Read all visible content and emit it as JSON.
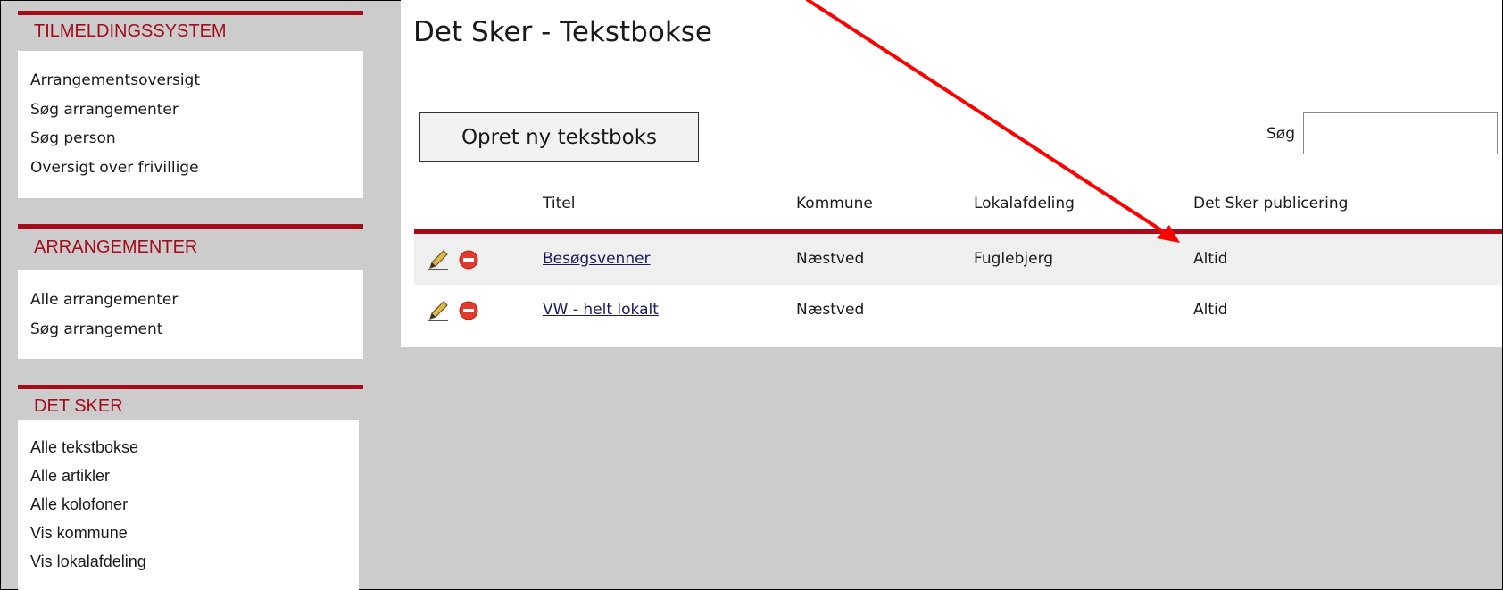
{
  "sidebar": {
    "panels": [
      {
        "title": "TILMELDINGSSYSTEM",
        "items": [
          "Arrangementsoversigt",
          "Søg arrangementer",
          "Søg person",
          "Oversigt over frivillige"
        ]
      },
      {
        "title": "ARRANGEMENTER",
        "items": [
          "Alle arrangementer",
          "Søg arrangement"
        ]
      },
      {
        "title": "DET SKER",
        "items": [
          "Alle tekstbokse",
          "Alle artikler",
          "Alle kolofoner",
          "Vis kommune",
          "Vis lokalafdeling"
        ]
      }
    ]
  },
  "main": {
    "title": "Det Sker - Tekstbokse",
    "create_button": "Opret ny tekstboks",
    "search": {
      "label": "Søg",
      "value": ""
    },
    "columns": [
      "Titel",
      "Kommune",
      "Lokalafdeling",
      "Det Sker publicering"
    ],
    "rows": [
      {
        "titel": "Besøgsvenner",
        "kommune": "Næstved",
        "lokalafdeling": "Fuglebjerg",
        "publicering": "Altid"
      },
      {
        "titel": "VW - helt lokalt",
        "kommune": "Næstved",
        "lokalafdeling": "",
        "publicering": "Altid"
      }
    ],
    "icons": {
      "edit": "pencil-icon",
      "delete": "minus-circle-icon"
    }
  },
  "colors": {
    "accent": "#a50c1a",
    "annotation_arrow": "#ff0000"
  }
}
